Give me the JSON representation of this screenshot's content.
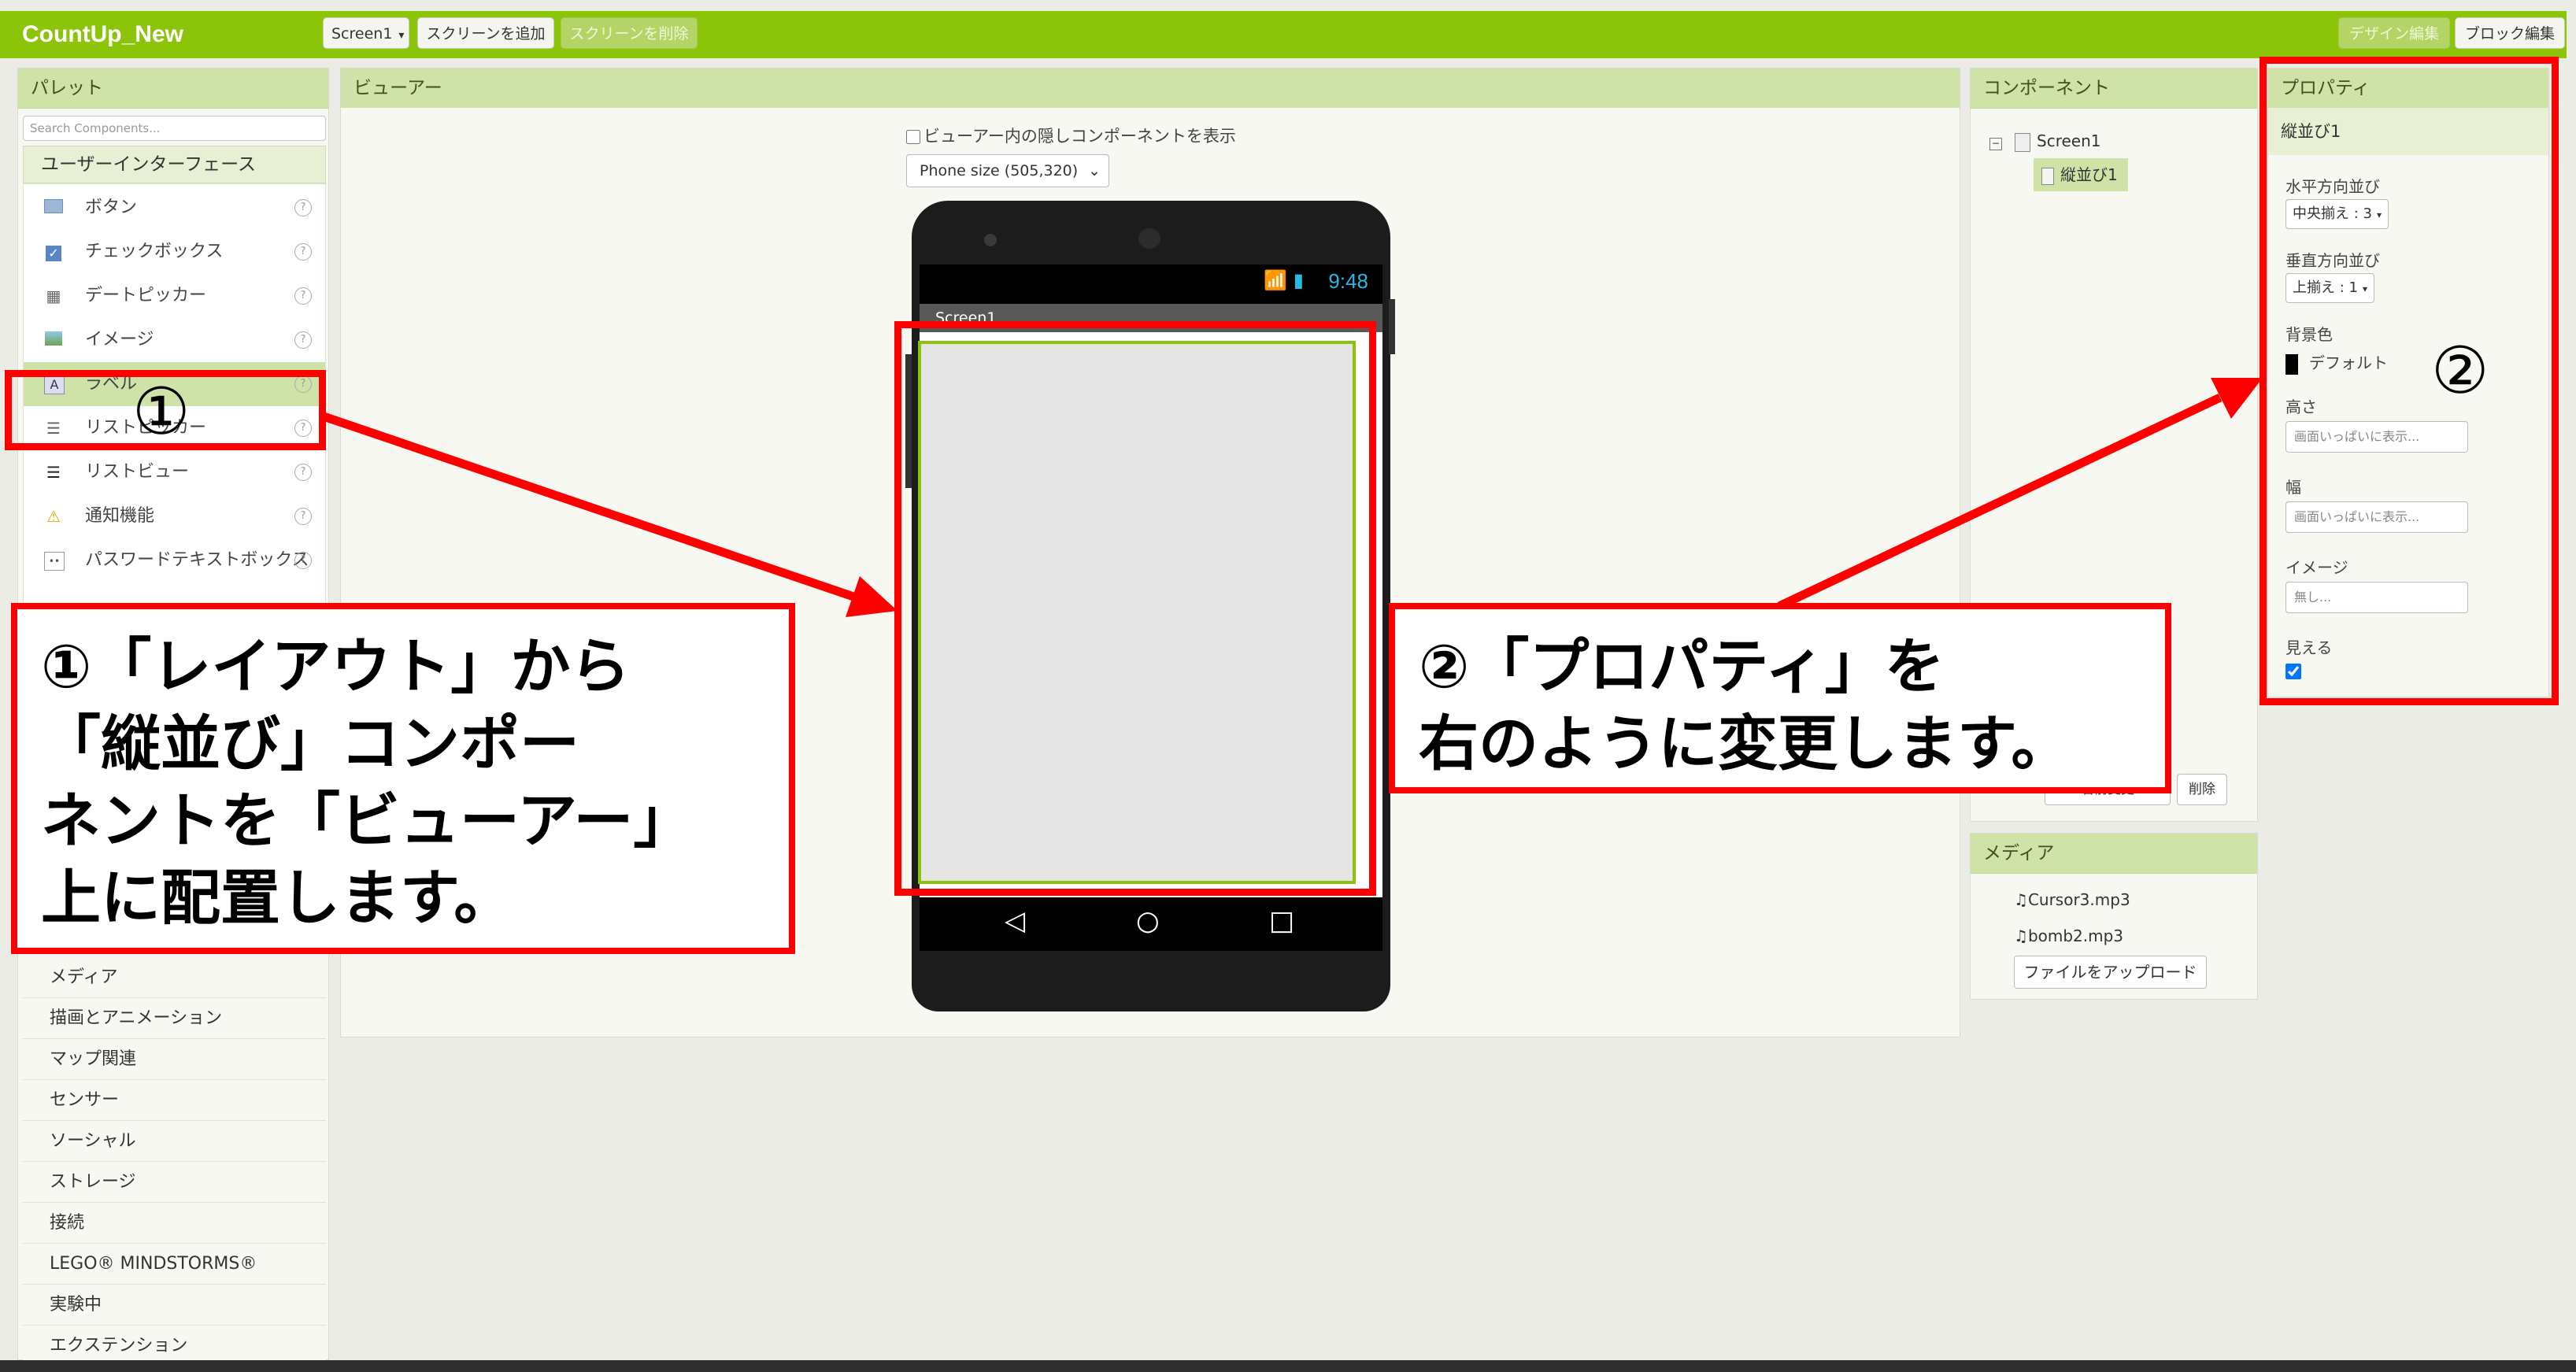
{
  "app": {
    "title": "CountUp_New"
  },
  "toolbar": {
    "screen_select": "Screen1",
    "add_screen": "スクリーンを追加",
    "remove_screen": "スクリーンを削除",
    "designer": "デザイン編集",
    "blocks": "ブロック編集"
  },
  "palette": {
    "header": "パレット",
    "search_placeholder": "Search Components...",
    "section": "ユーザーインターフェース",
    "items": [
      {
        "label": "ボタン",
        "icon": "button-icon"
      },
      {
        "label": "チェックボックス",
        "icon": "checkbox-icon"
      },
      {
        "label": "デートピッカー",
        "icon": "datepicker-icon"
      },
      {
        "label": "イメージ",
        "icon": "image-icon"
      },
      {
        "label": "ラベル",
        "icon": "label-icon"
      },
      {
        "label": "リストピッカー",
        "icon": "listpicker-icon"
      },
      {
        "label": "リストビュー",
        "icon": "listview-icon"
      },
      {
        "label": "通知機能",
        "icon": "notifier-icon"
      },
      {
        "label": "パスワードテキストボックス",
        "icon": "password-icon"
      }
    ],
    "categories": [
      "メディア",
      "描画とアニメーション",
      "マップ関連",
      "センサー",
      "ソーシャル",
      "ストレージ",
      "接続",
      "LEGO® MINDSTORMS®",
      "実験中",
      "エクステンション"
    ]
  },
  "viewer": {
    "header": "ビューアー",
    "show_hidden": "ビューアー内の隠しコンポーネントを表示",
    "size_select": "Phone size (505,320)",
    "status_time": "9:48",
    "screen_title": "Screen1"
  },
  "components": {
    "header": "コンポーネント",
    "root": "Screen1",
    "child": "縦並び1",
    "rename_button": "名前変更",
    "delete_button": "削除"
  },
  "media": {
    "header": "メディア",
    "files": [
      "Cursor3.mp3",
      "bomb2.mp3"
    ],
    "upload": "ファイルをアップロード"
  },
  "properties": {
    "header": "プロパティ",
    "component": "縦並び1",
    "align_h_label": "水平方向並び",
    "align_h_value": "中央揃え : 3",
    "align_v_label": "垂直方向並び",
    "align_v_value": "上揃え : 1",
    "bg_label": "背景色",
    "bg_value": "デフォルト",
    "height_label": "高さ",
    "height_value": "画面いっぱいに表示...",
    "width_label": "幅",
    "width_value": "画面いっぱいに表示...",
    "image_label": "イメージ",
    "image_value": "無し...",
    "visible_label": "見える"
  },
  "annotations": {
    "marker1": "①",
    "marker2": "②",
    "callout1_lines": [
      "①「レイアウト」から",
      "「縦並び」コンポー",
      "ネントを「ビューアー」",
      "上に配置します。"
    ],
    "callout2_lines": [
      "②「プロパティ」を",
      "右のように変更します。"
    ]
  },
  "colors": {
    "accent": "#8cc40a",
    "panel_header": "#cfe3a8",
    "annotation": "#ff0000"
  }
}
